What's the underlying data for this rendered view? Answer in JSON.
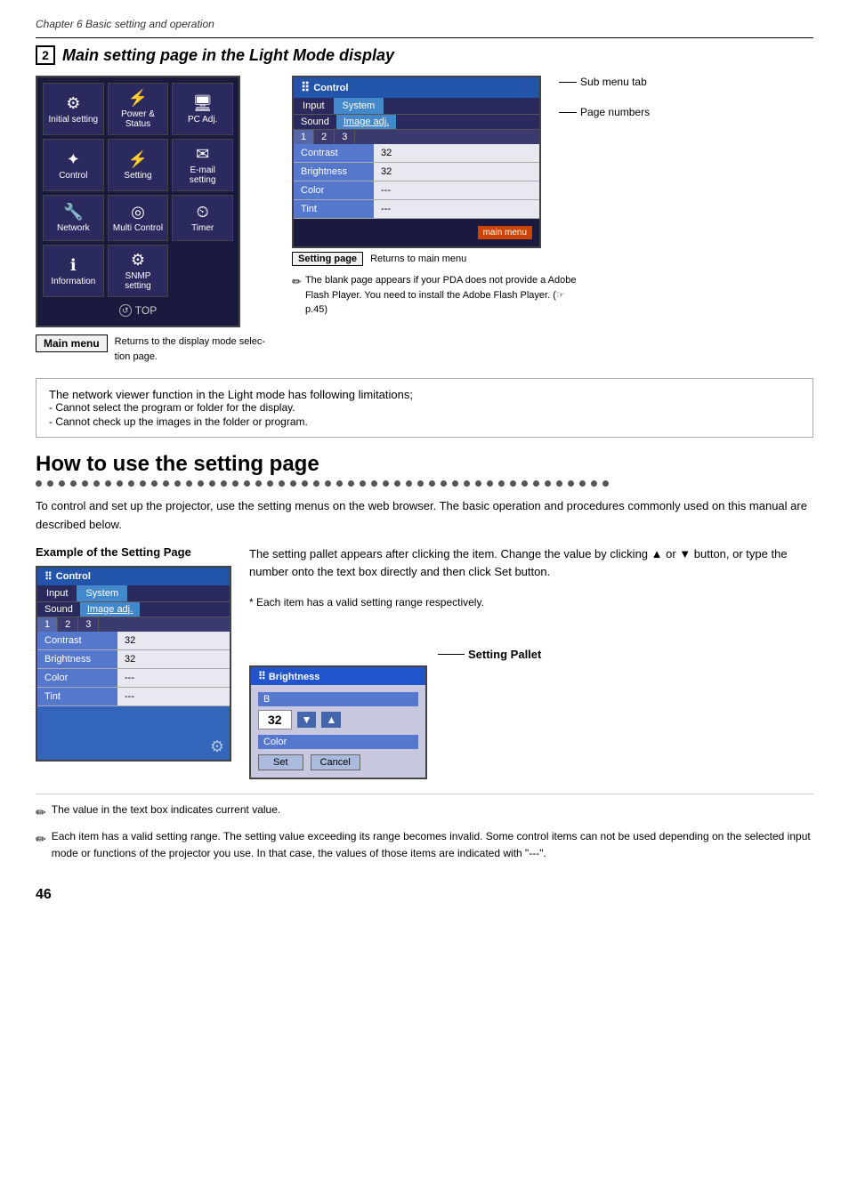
{
  "chapter": {
    "title": "Chapter 6 Basic setting and operation"
  },
  "section1": {
    "number": "2",
    "title": "Main setting page in the Light Mode display",
    "main_menu_label": "Main menu",
    "top_button": "TOP",
    "returns_display_label": "Returns to the display mode selec-\ntion page.",
    "setting_page_label": "Setting page",
    "returns_main_label": "Returns to main menu",
    "sub_menu_tab_label": "Sub menu tab",
    "page_numbers_label": "Page numbers",
    "blank_page_note": "The blank page appears if your PDA does not provide a Adobe Flash Player. You need to install the Adobe Flash Player. (☞p.45)",
    "menu_items": [
      {
        "icon": "⚙",
        "label": "Initial setting"
      },
      {
        "icon": "⚠",
        "label": "Power & Status"
      },
      {
        "icon": "🖥",
        "label": "PC Adj."
      },
      {
        "icon": "✦",
        "label": "Control"
      },
      {
        "icon": "⚡",
        "label": "Setting"
      },
      {
        "icon": "✉",
        "label": "E-mail setting"
      },
      {
        "icon": "🔧",
        "label": "Network"
      },
      {
        "icon": "◎",
        "label": "Multi Control"
      },
      {
        "icon": "⏲",
        "label": "Timer"
      },
      {
        "icon": "ℹ",
        "label": "Information"
      },
      {
        "icon": "⚙",
        "label": "SNMP setting"
      }
    ],
    "control_panel": {
      "header": "Control",
      "tabs": [
        "Input",
        "System",
        "Sound",
        "Image adj."
      ],
      "page_tabs": [
        "1",
        "2",
        "3"
      ],
      "rows": [
        {
          "label": "Contrast",
          "value": "32"
        },
        {
          "label": "Brightness",
          "value": "32"
        },
        {
          "label": "Color",
          "value": "---"
        },
        {
          "label": "Tint",
          "value": "---"
        }
      ],
      "main_menu_btn": "main menu"
    }
  },
  "callout": {
    "title": "The network viewer function in the Light mode has following limitations;",
    "lines": [
      "- Cannot select the program or folder for the display.",
      "- Cannot check up the images in the folder or program."
    ]
  },
  "section2": {
    "title": "How to use the setting page",
    "body": "To control and set up the projector, use the setting menus on the web browser. The basic operation and procedures commonly used on this manual are described below.",
    "example_label": "Example of the Setting Page",
    "setting_pallet_text": "The setting pallet appears after clicking the item. Change the value by clicking ▲ or ▼ button, or type the number onto the text box directly and then click Set button.",
    "each_item_note": "* Each item has a valid setting range respectively.",
    "setting_pallet_label": "Setting Pallet",
    "control_panel": {
      "header": "Control",
      "tabs": [
        "Input",
        "System",
        "Sound",
        "Image adj."
      ],
      "page_tabs": [
        "1",
        "2",
        "3"
      ],
      "rows": [
        {
          "label": "Contrast",
          "value": "32"
        },
        {
          "label": "Brightness",
          "value": "32"
        },
        {
          "label": "Color",
          "value": "---"
        },
        {
          "label": "Tint",
          "value": "---"
        }
      ]
    },
    "setting_pallet": {
      "header": "Brightness",
      "value": "32",
      "color_row": "Color",
      "set_btn": "Set",
      "cancel_btn": "Cancel"
    }
  },
  "footnotes": [
    "The value in the text box indicates current value.",
    "Each item has a valid setting range. The setting value exceeding its range becomes invalid. Some control items can not be used depending on the selected input mode or functions of the projector you use. In that case, the values of those items are indicated with \"---\"."
  ],
  "page_number": "46"
}
